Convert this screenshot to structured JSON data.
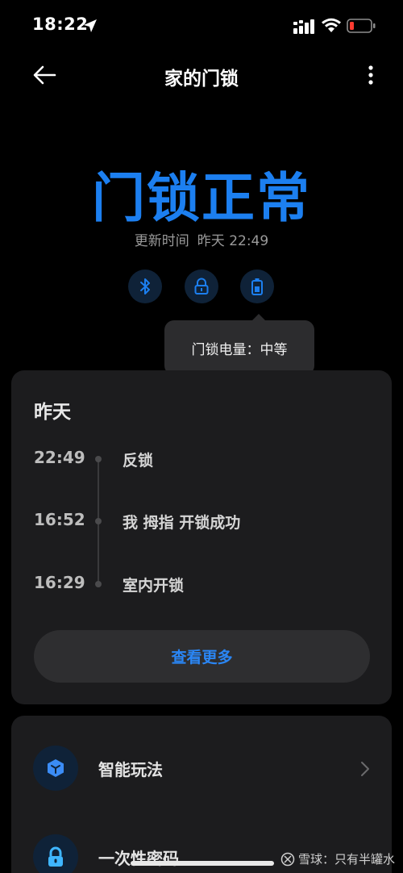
{
  "status_bar": {
    "time": "18:22"
  },
  "header": {
    "title": "家的门锁"
  },
  "lock": {
    "status": "门锁正常",
    "update_label": "更新时间",
    "update_time": "昨天 22:49",
    "tooltip": "门锁电量：中等"
  },
  "icons": {
    "bluetooth": "bluetooth-icon",
    "lock": "lock-icon",
    "battery": "battery-icon"
  },
  "log": {
    "day": "昨天",
    "entries": [
      {
        "time": "22:49",
        "text": "反锁"
      },
      {
        "time": "16:52",
        "text": "我 拇指 开锁成功"
      },
      {
        "time": "16:29",
        "text": "室内开锁"
      }
    ],
    "view_more": "查看更多"
  },
  "features": [
    {
      "label": "智能玩法",
      "icon": "cube-icon"
    },
    {
      "label": "一次性密码",
      "icon": "padlock-icon"
    }
  ],
  "watermark": "雪球：只有半罐水",
  "colors": {
    "accent": "#1c7ff0",
    "card": "#1c1c1e",
    "battery_low": "#ff3b30"
  }
}
